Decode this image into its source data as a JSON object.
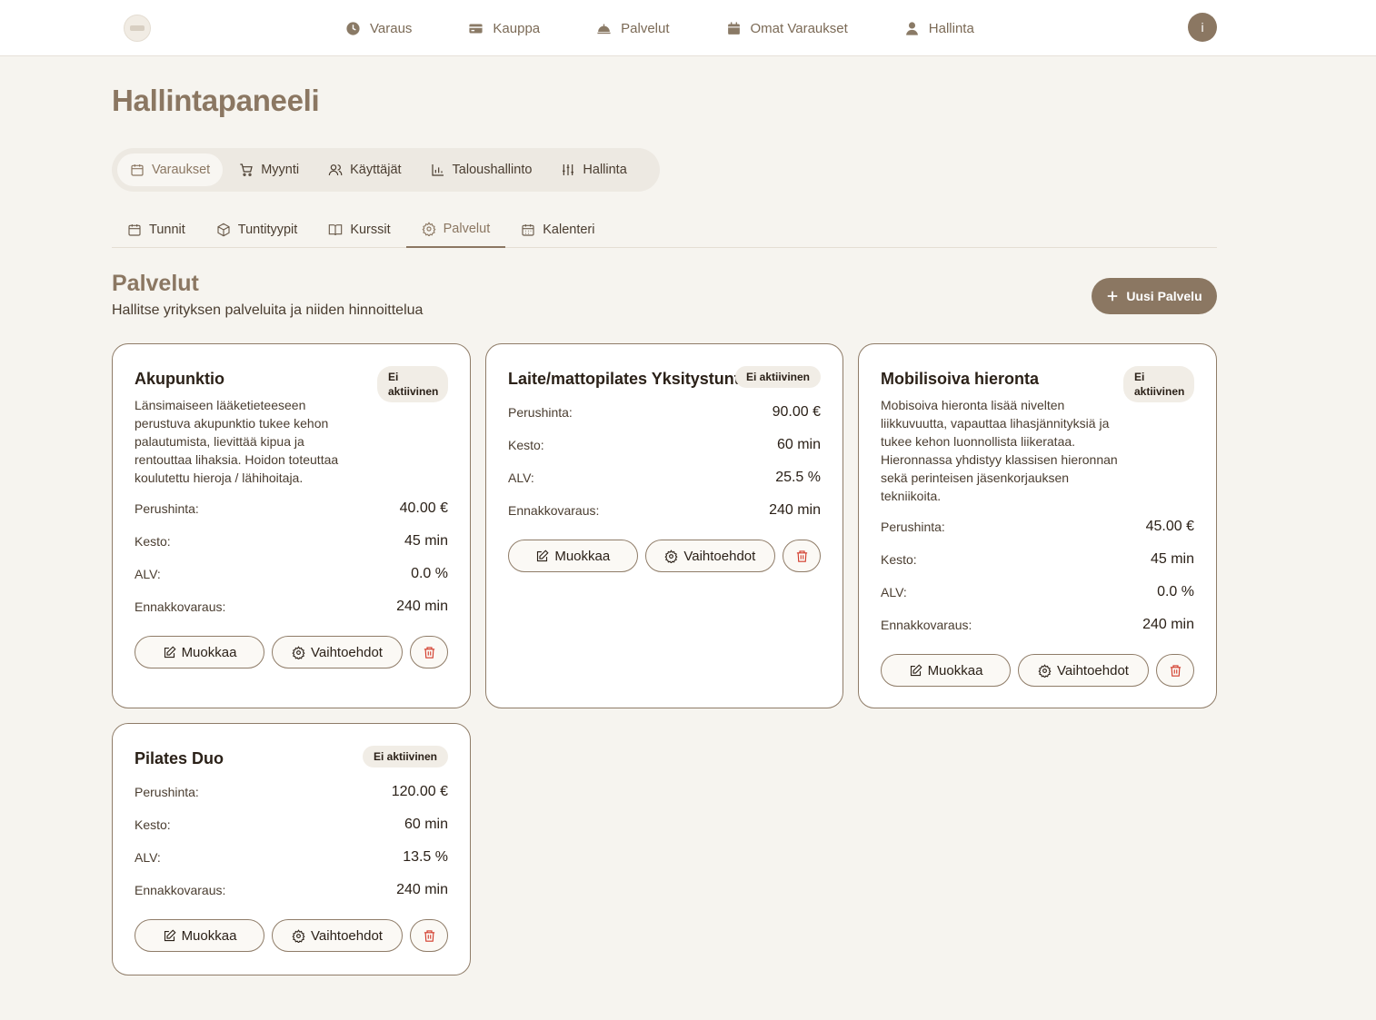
{
  "nav": {
    "items": [
      {
        "label": "Varaus",
        "icon": "clock-icon"
      },
      {
        "label": "Kauppa",
        "icon": "wallet-icon"
      },
      {
        "label": "Palvelut",
        "icon": "service-bell-icon"
      },
      {
        "label": "Omat Varaukset",
        "icon": "calendar-icon"
      },
      {
        "label": "Hallinta",
        "icon": "user-icon"
      }
    ],
    "avatar_initial": "i"
  },
  "page": {
    "title": "Hallintapaneeli"
  },
  "main_tabs": [
    {
      "label": "Varaukset",
      "icon": "calendar-icon",
      "active": true
    },
    {
      "label": "Myynti",
      "icon": "cart-icon",
      "active": false
    },
    {
      "label": "Käyttäjät",
      "icon": "users-icon",
      "active": false
    },
    {
      "label": "Taloushallinto",
      "icon": "bar-chart-icon",
      "active": false
    },
    {
      "label": "Hallinta",
      "icon": "sliders-icon",
      "active": false
    }
  ],
  "sub_tabs": [
    {
      "label": "Tunnit",
      "icon": "calendar-icon",
      "active": false
    },
    {
      "label": "Tuntityypit",
      "icon": "box-icon",
      "active": false
    },
    {
      "label": "Kurssit",
      "icon": "book-icon",
      "active": false
    },
    {
      "label": "Palvelut",
      "icon": "gear-icon",
      "active": true
    },
    {
      "label": "Kalenteri",
      "icon": "calendar-grid-icon",
      "active": false
    }
  ],
  "section": {
    "title": "Palvelut",
    "subtitle": "Hallitse yrityksen palveluita ja niiden hinnoittelua",
    "new_button": "Uusi Palvelu"
  },
  "labels": {
    "price": "Perushinta:",
    "duration": "Kesto:",
    "vat": "ALV:",
    "advance": "Ennakkovaraus:",
    "edit": "Muokkaa",
    "options": "Vaihtoehdot"
  },
  "services": [
    {
      "name": "Akupunktio",
      "status": "Ei aktiivinen",
      "description": "Länsimaiseen lääketieteeseen perustuva akupunktio tukee kehon palautumista, lievittää kipua ja rentouttaa lihaksia. Hoidon toteuttaa koulutettu hieroja / lähihoitaja.",
      "price": "40.00 €",
      "duration": "45 min",
      "vat": "0.0 %",
      "advance": "240 min"
    },
    {
      "name": "Laite/mattopilates Yksitystunti",
      "status": "Ei aktiivinen",
      "description": "",
      "price": "90.00 €",
      "duration": "60 min",
      "vat": "25.5 %",
      "advance": "240 min"
    },
    {
      "name": "Mobilisoiva hieronta",
      "status": "Ei aktiivinen",
      "description": "Mobisoiva hieronta lisää nivelten liikkuvuutta, vapauttaa lihasjännityksiä ja tukee kehon luonnollista liikerataa. Hieronnassa yhdistyy klassisen hieronnan sekä perinteisen jäsenkorjauksen tekniikoita.",
      "price": "45.00 €",
      "duration": "45 min",
      "vat": "0.0 %",
      "advance": "240 min"
    },
    {
      "name": "Pilates Duo",
      "status": "Ei aktiivinen",
      "description": "",
      "price": "120.00 €",
      "duration": "60 min",
      "vat": "13.5 %",
      "advance": "240 min"
    }
  ]
}
